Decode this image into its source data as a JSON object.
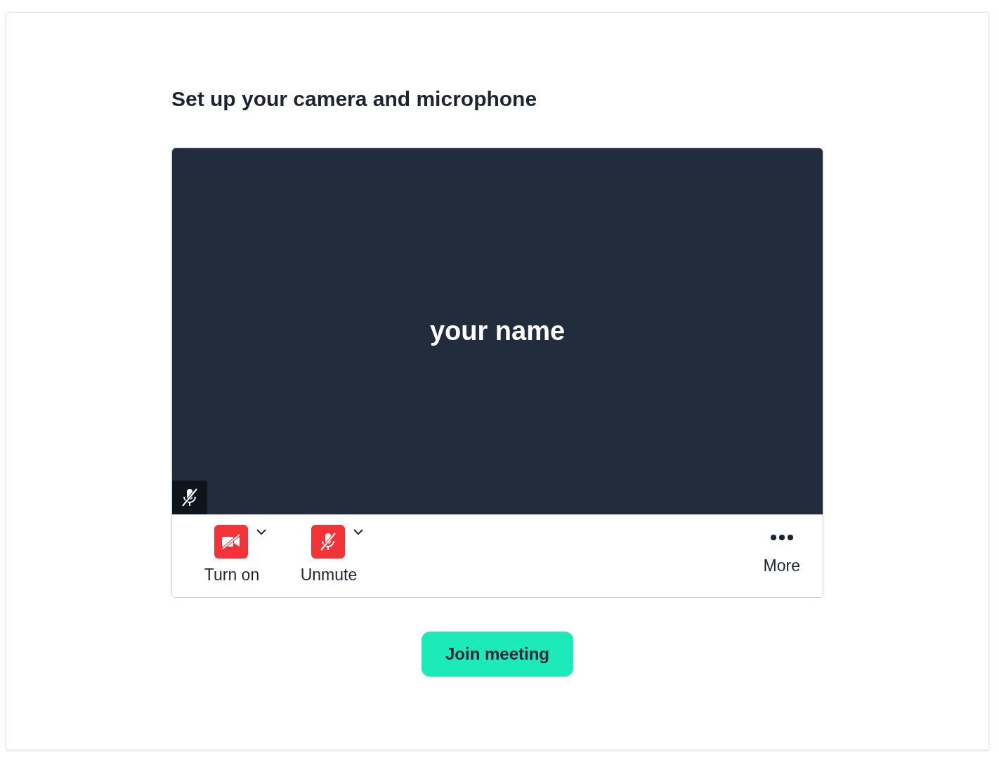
{
  "title": "Set up your camera and microphone",
  "preview": {
    "name": "your name",
    "mic_muted": true
  },
  "controls": [
    {
      "kind": "camera",
      "label": "Turn on",
      "on": false
    },
    {
      "kind": "microphone",
      "label": "Unmute",
      "on": false
    }
  ],
  "more": {
    "label": "More"
  },
  "join_button": "Join meeting"
}
